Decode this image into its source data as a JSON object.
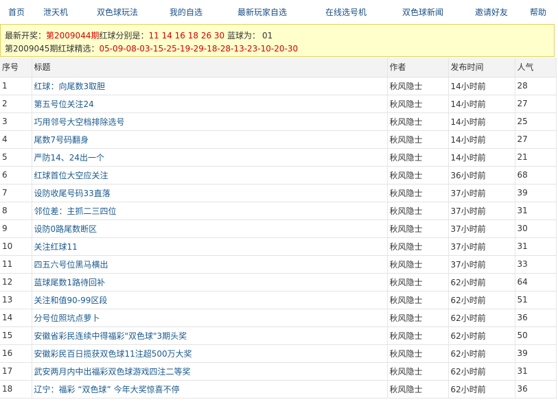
{
  "nav": [
    {
      "label": "首页"
    },
    {
      "label": "泄天机"
    },
    {
      "label": "双色球玩法"
    },
    {
      "label": "我的自选"
    },
    {
      "label": "最新玩家自选"
    },
    {
      "label": "在线选号机"
    },
    {
      "label": "双色球新闻"
    },
    {
      "label": "邀请好友"
    },
    {
      "label": "帮助"
    }
  ],
  "notice": {
    "prefix": "最新开奖：",
    "period": "第2009044期",
    "red_label": "红球分别是：",
    "red_numbers": "11 14 16 18 26 30",
    "blue_label": " 蓝球为：",
    "blue_number": "01",
    "pick_label": "第2009045期红球精选：",
    "pick_numbers": "05-09-08-03-15-25-19-29-18-28-13-23-10-20-30"
  },
  "table": {
    "headers": {
      "num": "序号",
      "title": "标题",
      "author": "作者",
      "time": "发布时间",
      "hits": "人气"
    },
    "rows": [
      {
        "num": "1",
        "title": "红球：向尾数3取胆",
        "author": "秋风隐士",
        "time": "14小时前",
        "hits": "28"
      },
      {
        "num": "2",
        "title": "第五号位关注24",
        "author": "秋风隐士",
        "time": "14小时前",
        "hits": "27"
      },
      {
        "num": "3",
        "title": "巧用邻号大空档排除选号",
        "author": "秋风隐士",
        "time": "14小时前",
        "hits": "25"
      },
      {
        "num": "4",
        "title": "尾数7号码翻身",
        "author": "秋风隐士",
        "time": "14小时前",
        "hits": "27"
      },
      {
        "num": "5",
        "title": "严防14、24出一个",
        "author": "秋风隐士",
        "time": "14小时前",
        "hits": "21"
      },
      {
        "num": "6",
        "title": "红球首位大空应关注",
        "author": "秋风隐士",
        "time": "36小时前",
        "hits": "68"
      },
      {
        "num": "7",
        "title": "设防收尾号码33直落",
        "author": "秋风隐士",
        "time": "37小时前",
        "hits": "39"
      },
      {
        "num": "8",
        "title": "邻位差：主抓二三四位",
        "author": "秋风隐士",
        "time": "37小时前",
        "hits": "31"
      },
      {
        "num": "9",
        "title": "设防0路尾数断区",
        "author": "秋风隐士",
        "time": "37小时前",
        "hits": "30"
      },
      {
        "num": "10",
        "title": "关注红球11",
        "author": "秋风隐士",
        "time": "37小时前",
        "hits": "31"
      },
      {
        "num": "11",
        "title": "四五六号位黑马横出",
        "author": "秋风隐士",
        "time": "37小时前",
        "hits": "33"
      },
      {
        "num": "12",
        "title": "蓝球尾数1路待回补",
        "author": "秋风隐士",
        "time": "62小时前",
        "hits": "64"
      },
      {
        "num": "13",
        "title": "关注和值90-99区段",
        "author": "秋风隐士",
        "time": "62小时前",
        "hits": "51"
      },
      {
        "num": "14",
        "title": "分号位照坑点萝卜",
        "author": "秋风隐士",
        "time": "62小时前",
        "hits": "36"
      },
      {
        "num": "15",
        "title": "安徽省彩民连续中得福彩\"双色球\"3期头奖",
        "author": "秋风隐士",
        "time": "62小时前",
        "hits": "50"
      },
      {
        "num": "16",
        "title": "安徽彩民百日揽获双色球11注超500万大奖",
        "author": "秋风隐士",
        "time": "62小时前",
        "hits": "39"
      },
      {
        "num": "17",
        "title": "武安两月内中出福彩双色球游戏四注二等奖",
        "author": "秋风隐士",
        "time": "62小时前",
        "hits": "31"
      },
      {
        "num": "18",
        "title": "辽宁：福彩 “双色球” 今年大奖惊喜不停",
        "author": "秋风隐士",
        "time": "62小时前",
        "hits": "36"
      }
    ]
  }
}
